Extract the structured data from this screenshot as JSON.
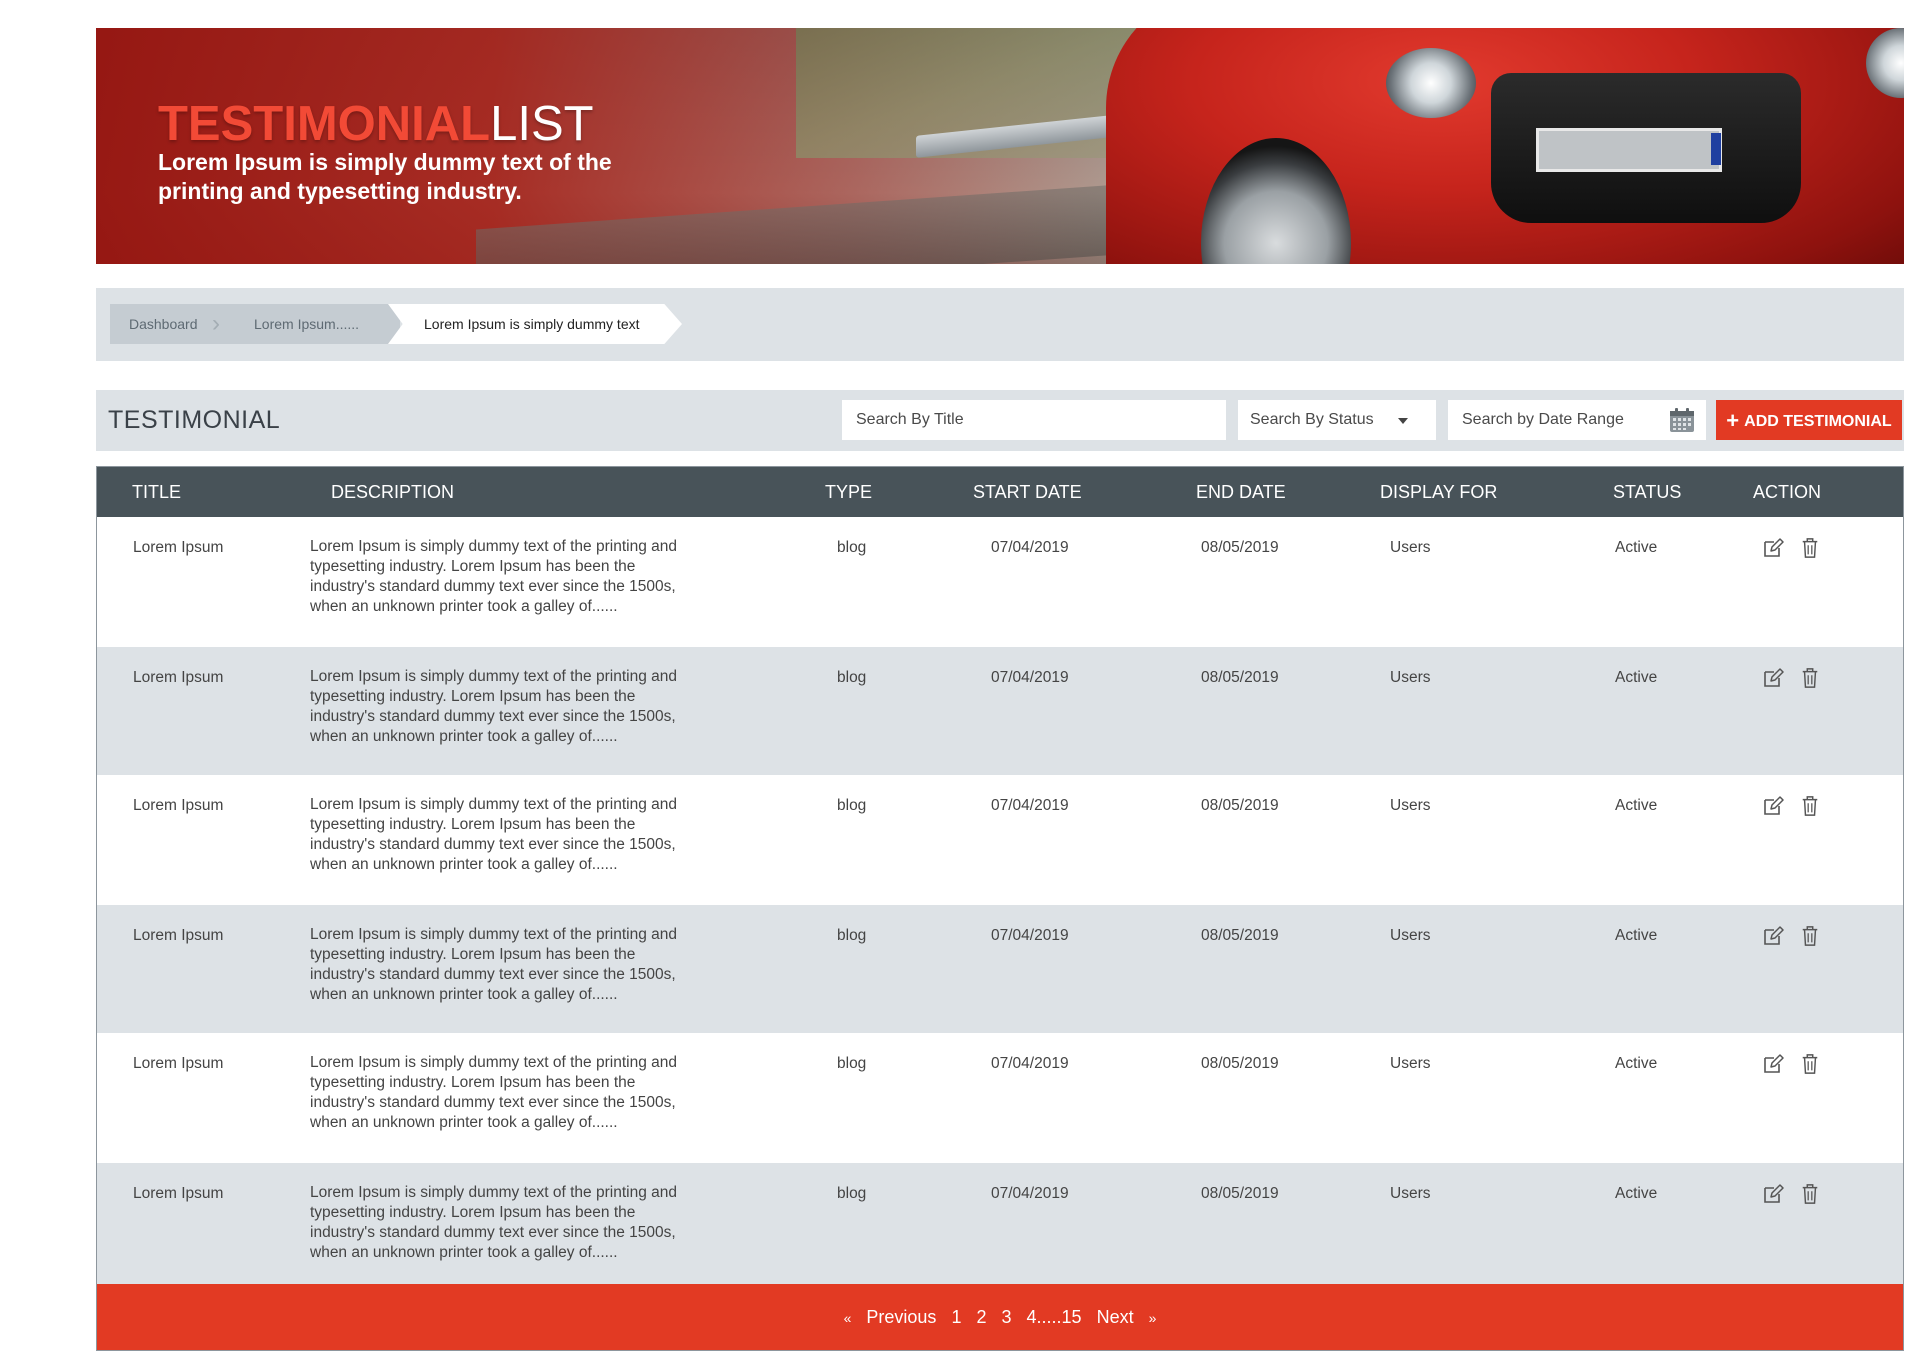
{
  "banner": {
    "title_highlight": "TESTIMONIAL",
    "title_rest": "LIST",
    "subtitle": "Lorem Ipsum is simply dummy text of the printing and typesetting industry."
  },
  "breadcrumb": {
    "items": [
      "Dashboard",
      "Lorem Ipsum......",
      "Lorem Ipsum is simply dummy text"
    ]
  },
  "toolbar": {
    "title": "TESTIMONIAL",
    "search_title_placeholder": "Search By Title",
    "search_status_label": "Search By Status",
    "search_date_placeholder": "Search by Date Range",
    "add_button_label": "ADD TESTIMONIAL"
  },
  "table": {
    "columns": [
      "TITLE",
      "DESCRIPTION",
      "TYPE",
      "START DATE",
      "END DATE",
      "DISPLAY FOR",
      "STATUS",
      "ACTION"
    ],
    "rows": [
      {
        "title": "Lorem Ipsum",
        "description": "Lorem Ipsum is simply dummy text of the printing and typesetting industry. Lorem Ipsum has been the industry's standard dummy text ever since the 1500s, when an unknown printer took a galley of......",
        "type": "blog",
        "start": "07/04/2019",
        "end": "08/05/2019",
        "display_for": "Users",
        "status": "Active"
      },
      {
        "title": "Lorem Ipsum",
        "description": "Lorem Ipsum is simply dummy text of the printing and typesetting industry. Lorem Ipsum has been the industry's standard dummy text ever since the 1500s, when an unknown printer took a galley of......",
        "type": "blog",
        "start": "07/04/2019",
        "end": "08/05/2019",
        "display_for": "Users",
        "status": "Active"
      },
      {
        "title": "Lorem Ipsum",
        "description": "Lorem Ipsum is simply dummy text of the printing and typesetting industry. Lorem Ipsum has been the industry's standard dummy text ever since the 1500s, when an unknown printer took a galley of......",
        "type": "blog",
        "start": "07/04/2019",
        "end": "08/05/2019",
        "display_for": "Users",
        "status": "Active"
      },
      {
        "title": "Lorem Ipsum",
        "description": "Lorem Ipsum is simply dummy text of the printing and typesetting industry. Lorem Ipsum has been the industry's standard dummy text ever since the 1500s, when an unknown printer took a galley of......",
        "type": "blog",
        "start": "07/04/2019",
        "end": "08/05/2019",
        "display_for": "Users",
        "status": "Active"
      },
      {
        "title": "Lorem Ipsum",
        "description": "Lorem Ipsum is simply dummy text of the printing and typesetting industry. Lorem Ipsum has been the industry's standard dummy text ever since the 1500s, when an unknown printer took a galley of......",
        "type": "blog",
        "start": "07/04/2019",
        "end": "08/05/2019",
        "display_for": "Users",
        "status": "Active"
      },
      {
        "title": "Lorem Ipsum",
        "description": "Lorem Ipsum is simply dummy text of the printing and typesetting industry. Lorem Ipsum has been the industry's standard dummy text ever since the 1500s, when an unknown printer took a galley of......",
        "type": "blog",
        "start": "07/04/2019",
        "end": "08/05/2019",
        "display_for": "Users",
        "status": "Active"
      }
    ]
  },
  "pagination": {
    "prev_icon": "«",
    "prev": "Previous",
    "pages": [
      "1",
      "2",
      "3",
      "4.....15"
    ],
    "next": "Next",
    "next_icon": "»"
  },
  "icons": {
    "edit": "edit-icon",
    "delete": "trash-icon",
    "calendar": "calendar-icon",
    "dropdown": "chevron-down-icon",
    "add": "plus-icon"
  },
  "colors": {
    "accent": "#e23a23",
    "header": "#485359",
    "band": "#dde2e6"
  }
}
